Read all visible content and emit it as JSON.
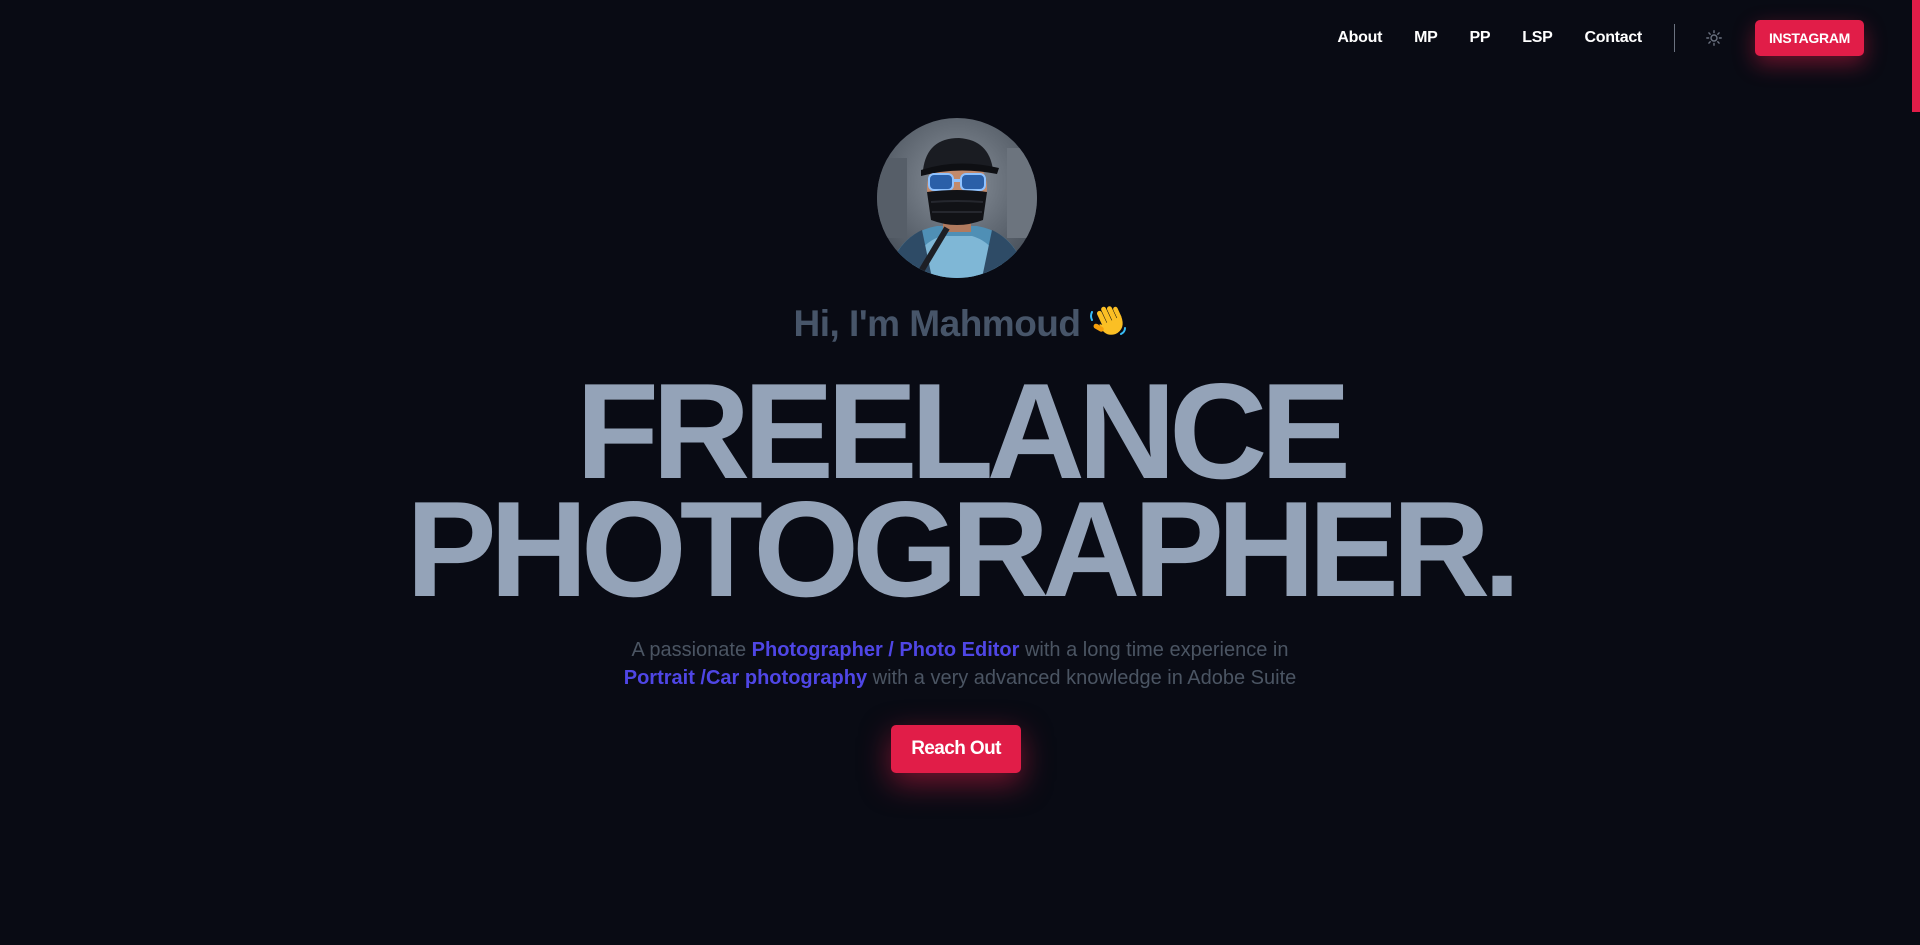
{
  "nav": {
    "links": [
      {
        "label": "About"
      },
      {
        "label": "MP"
      },
      {
        "label": "PP"
      },
      {
        "label": "LSP"
      },
      {
        "label": "Contact"
      }
    ],
    "theme_toggle_icon": "sun-icon",
    "instagram_label": "INSTAGRAM"
  },
  "hero": {
    "avatar_icon": "profile-photo",
    "greeting": "Hi, I'm Mahmoud",
    "greeting_emoji": "👋",
    "headline_line1": "FREELANCE",
    "headline_line2": "PHOTOGRAPHER.",
    "subtitle": {
      "line1_prefix": "A passionate ",
      "line1_highlight": "Photographer / Photo Editor",
      "line1_suffix": " with a long time experience in",
      "line2_highlight": "Portrait /Car photography",
      "line2_suffix": " with a very advanced knowledge in Adobe Suite"
    },
    "cta_label": "Reach Out"
  },
  "colors": {
    "background": "#090b14",
    "accent": "#e11d48",
    "highlight": "#4f46e5",
    "headline": "#94a3b8",
    "greeting": "#475569",
    "subtitle": "#4b5563"
  }
}
